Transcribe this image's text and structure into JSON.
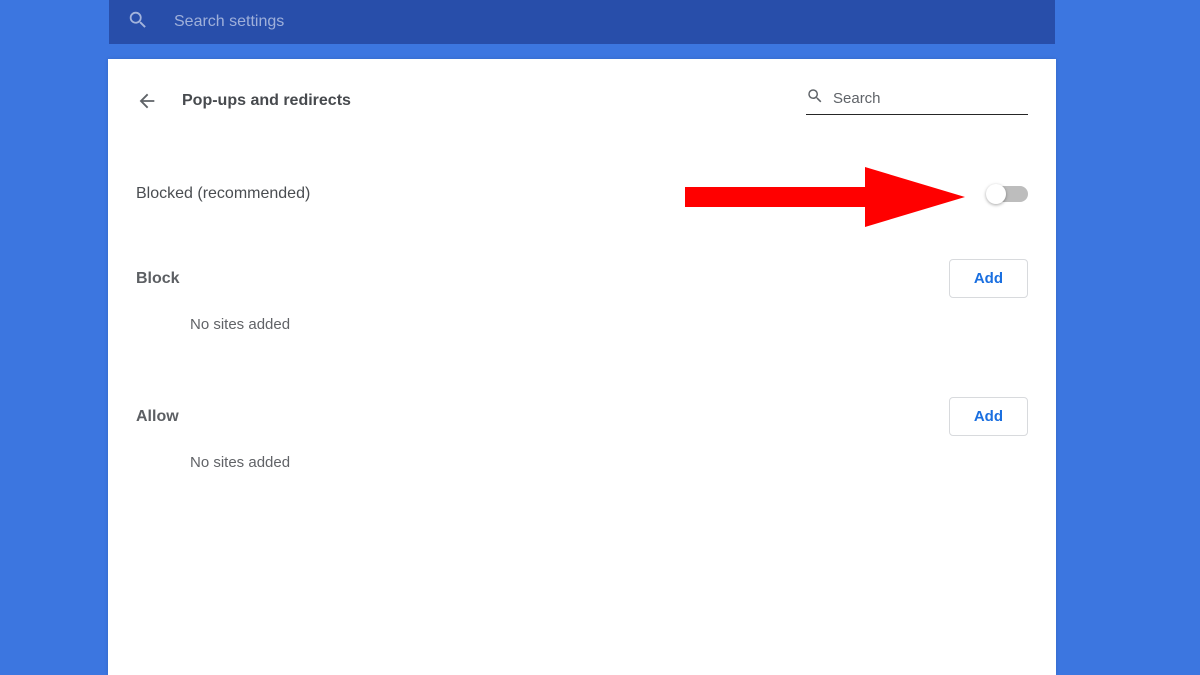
{
  "top_search": {
    "placeholder": "Search settings"
  },
  "page": {
    "title": "Pop-ups and redirects",
    "search_placeholder": "Search"
  },
  "toggle": {
    "label": "Blocked (recommended)",
    "state": "off"
  },
  "sections": {
    "block": {
      "label": "Block",
      "add_label": "Add",
      "empty_msg": "No sites added"
    },
    "allow": {
      "label": "Allow",
      "add_label": "Add",
      "empty_msg": "No sites added"
    }
  }
}
